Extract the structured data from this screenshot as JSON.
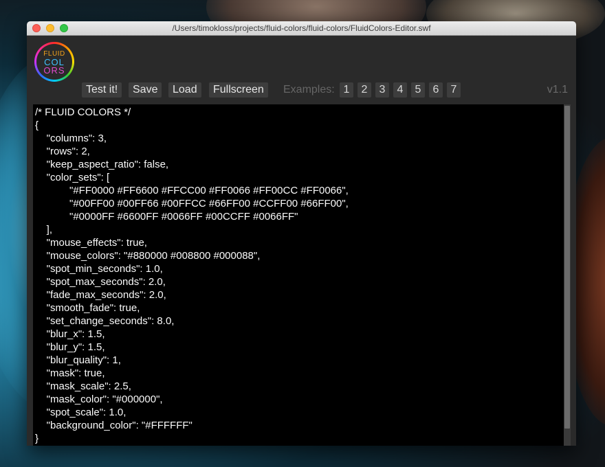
{
  "window": {
    "title": "/Users/timokloss/projects/fluid-colors/fluid-colors/FluidColors-Editor.swf"
  },
  "logo": {
    "line1": "FLUID",
    "line2": "COL",
    "line3": "ORS"
  },
  "toolbar": {
    "test_label": "Test it!",
    "save_label": "Save",
    "load_label": "Load",
    "fullscreen_label": "Fullscreen",
    "examples_label": "Examples:",
    "examples": [
      "1",
      "2",
      "3",
      "4",
      "5",
      "6",
      "7"
    ],
    "version": "v1.1"
  },
  "editor": {
    "content": "/* FLUID COLORS */\n{\n    \"columns\": 3,\n    \"rows\": 2,\n    \"keep_aspect_ratio\": false,\n    \"color_sets\": [\n            \"#FF0000 #FF6600 #FFCC00 #FF0066 #FF00CC #FF0066\",\n            \"#00FF00 #00FF66 #00FFCC #66FF00 #CCFF00 #66FF00\",\n            \"#0000FF #6600FF #0066FF #00CCFF #0066FF\"\n    ],\n    \"mouse_effects\": true,\n    \"mouse_colors\": \"#880000 #008800 #000088\",\n    \"spot_min_seconds\": 1.0,\n    \"spot_max_seconds\": 2.0,\n    \"fade_max_seconds\": 2.0,\n    \"smooth_fade\": true,\n    \"set_change_seconds\": 8.0,\n    \"blur_x\": 1.5,\n    \"blur_y\": 1.5,\n    \"blur_quality\": 1,\n    \"mask\": true,\n    \"mask_scale\": 2.5,\n    \"mask_color\": \"#000000\",\n    \"spot_scale\": 1.0,\n    \"background_color\": \"#FFFFFF\"\n}"
  },
  "colors": {
    "app_background": "#2a2a2a",
    "editor_background": "#000000",
    "editor_text": "#fafafa",
    "button_background": "#3d3d3d"
  }
}
